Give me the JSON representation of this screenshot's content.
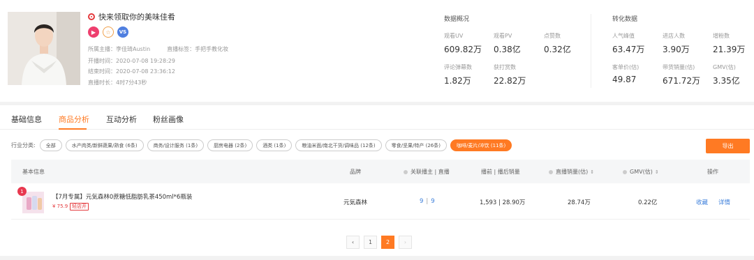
{
  "room": {
    "title": "快来领取你的美味佳肴",
    "host_label": "所属主播：李佳琦Austin",
    "tag_label": "直播标签：手把手教化妆",
    "start_label": "开播时间：2020-07-08 19:28:29",
    "end_label": "结束时间：2020-07-08 23:36:12",
    "duration_label": "直播时长：4时7分43秒",
    "badges": [
      "play-icon",
      "star-icon",
      "vs-icon"
    ],
    "vs_text": "VS"
  },
  "overview": {
    "title": "数据概况",
    "stats": [
      {
        "label": "观看UV",
        "value": "609.82万"
      },
      {
        "label": "观看PV",
        "value": "0.38亿"
      },
      {
        "label": "点赞数",
        "value": "0.32亿"
      },
      {
        "label": "评论弹幕数",
        "value": "1.82万"
      },
      {
        "label": "获打赏数",
        "value": "22.82万"
      }
    ]
  },
  "conversion": {
    "title": "转化数据",
    "stats": [
      {
        "label": "人气峰值",
        "value": "63.47万"
      },
      {
        "label": "进店人数",
        "value": "3.90万"
      },
      {
        "label": "增粉数",
        "value": "21.39万"
      },
      {
        "label": "客单价(估)",
        "value": "49.87"
      },
      {
        "label": "带货销量(估)",
        "value": "671.72万"
      },
      {
        "label": "GMV(估)",
        "value": "3.35亿"
      }
    ]
  },
  "tabs": [
    "基础信息",
    "商品分析",
    "互动分析",
    "粉丝画像"
  ],
  "active_tab": 1,
  "filters": {
    "label": "行业分类:",
    "chips": [
      "全部",
      "水产肉类/新鲜蔬果/熟食 (6条)",
      "商务/设计服务 (1条)",
      "厨房电器 (2条)",
      "酒类 (1条)",
      "粮油米面/南北干货/调味品 (12条)",
      "零食/坚果/特产 (26条)",
      "咖啡/麦片/冲饮 (11条)"
    ],
    "active_index": 7
  },
  "export_label": "导出",
  "table": {
    "headers": {
      "basic": "基本信息",
      "brand": "品牌",
      "anchors": "关联播主 | 直播",
      "sales_before_after": "播前 | 播后销量",
      "live_sales": "直播销量(估)",
      "gmv": "GMV(估)",
      "ops": "操作"
    },
    "sort_glyph": "⇕",
    "rows": [
      {
        "rank": "1",
        "name": "【7月专属】元気森林0蔗糖低脂肪乳茶450ml*6瓶装",
        "price": "¥ 75.9",
        "tag": "轻店开",
        "brand": "元気森林",
        "anchors": "9",
        "lives": "9",
        "sales": "1,593 | 28.90万",
        "live_sales": "28.74万",
        "gmv": "0.22亿",
        "op_fav": "收藏",
        "op_detail": "详情"
      }
    ]
  },
  "pager": {
    "prev": "‹",
    "pages": [
      "1",
      "2"
    ],
    "active": "2",
    "next": "›"
  }
}
